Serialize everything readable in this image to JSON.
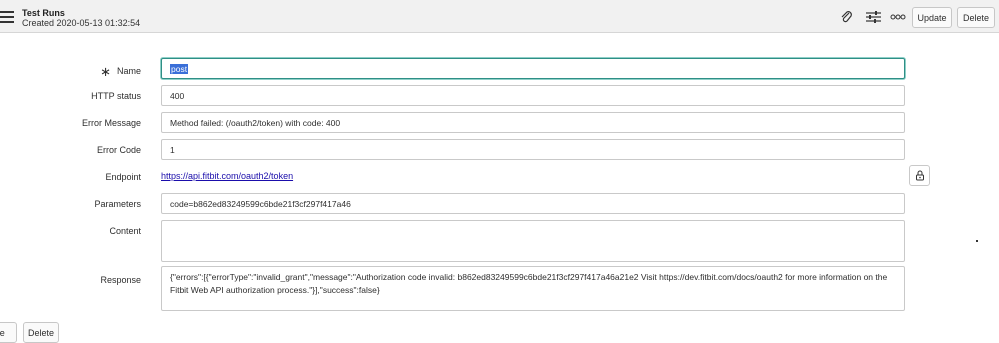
{
  "header": {
    "title": "Test Runs",
    "subtitle": "Created 2020-05-13 01:32:54",
    "update_label": "Update",
    "delete_label": "Delete"
  },
  "form": {
    "name": {
      "label": "Name",
      "value": "post"
    },
    "http_status": {
      "label": "HTTP status",
      "value": "400"
    },
    "error_message": {
      "label": "Error Message",
      "value": "Method failed: (/oauth2/token) with code: 400"
    },
    "error_code": {
      "label": "Error Code",
      "value": "1"
    },
    "endpoint": {
      "label": "Endpoint",
      "value": "https://api.fitbit.com/oauth2/token"
    },
    "parameters": {
      "label": "Parameters",
      "value": "code=b862ed83249599c6bde21f3cf297f417a46"
    },
    "content": {
      "label": "Content",
      "value": ""
    },
    "response": {
      "label": "Response",
      "value": "{\"errors\":[{\"errorType\":\"invalid_grant\",\"message\":\"Authorization code invalid: b862ed83249599c6bde21f3cf297f417a46a21e2 Visit https://dev.fitbit.com/docs/oauth2 for more information on the Fitbit Web API authorization process.\"}],\"success\":false}"
    }
  },
  "footer": {
    "update_label": "ate",
    "delete_label": "Delete"
  }
}
